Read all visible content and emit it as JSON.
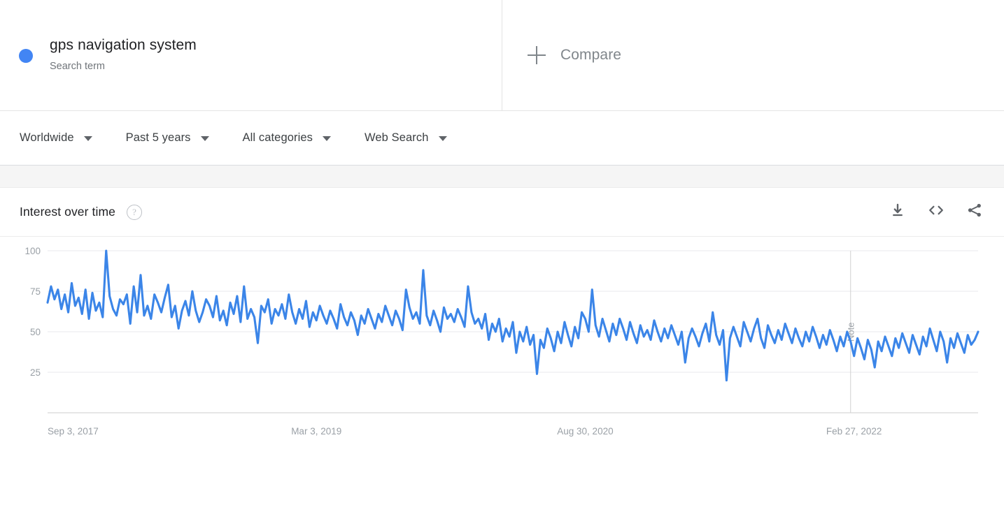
{
  "term": {
    "dot_color": "#4285f4",
    "title": "gps navigation system",
    "subtitle": "Search term"
  },
  "compare": {
    "label": "Compare",
    "plus_icon": "plus-icon"
  },
  "filters": [
    {
      "label": "Worldwide",
      "icon": "chevron-down-icon"
    },
    {
      "label": "Past 5 years",
      "icon": "chevron-down-icon"
    },
    {
      "label": "All categories",
      "icon": "chevron-down-icon"
    },
    {
      "label": "Web Search",
      "icon": "chevron-down-icon"
    }
  ],
  "card": {
    "title": "Interest over time",
    "help_icon": "help-circle-icon",
    "help_glyph": "?",
    "actions": [
      {
        "name": "download-icon",
        "tooltip": "Download"
      },
      {
        "name": "embed-code-icon",
        "tooltip": "Embed"
      },
      {
        "name": "share-icon",
        "tooltip": "Share"
      }
    ]
  },
  "chart_data": {
    "type": "line",
    "title": "Interest over time",
    "xlabel": "",
    "ylabel": "",
    "line_color": "#3b85e8",
    "ylim": [
      0,
      100
    ],
    "y_ticks": [
      100,
      75,
      50,
      25
    ],
    "grid": true,
    "legend_position": "top-left",
    "x_tick_labels": [
      "Sep 3, 2017",
      "Mar 3, 2019",
      "Aug 30, 2020",
      "Feb 27, 2022"
    ],
    "x_tick_indices": [
      0,
      78,
      156,
      234
    ],
    "annotations": [
      {
        "label": "Note",
        "x_index": 233,
        "orientation": "vertical"
      }
    ],
    "series": [
      {
        "name": "gps navigation system",
        "color": "#3b85e8",
        "values": [
          68,
          78,
          70,
          76,
          64,
          73,
          62,
          80,
          66,
          71,
          61,
          76,
          58,
          74,
          63,
          68,
          59,
          100,
          72,
          64,
          60,
          70,
          67,
          73,
          55,
          78,
          62,
          85,
          60,
          66,
          58,
          73,
          68,
          62,
          71,
          79,
          59,
          66,
          52,
          63,
          69,
          60,
          75,
          63,
          56,
          62,
          70,
          66,
          59,
          72,
          57,
          63,
          54,
          68,
          61,
          72,
          56,
          78,
          58,
          64,
          59,
          43,
          66,
          62,
          70,
          55,
          64,
          60,
          67,
          58,
          73,
          62,
          55,
          64,
          58,
          69,
          53,
          62,
          57,
          66,
          60,
          55,
          63,
          58,
          52,
          67,
          59,
          54,
          62,
          57,
          48,
          60,
          55,
          64,
          58,
          52,
          61,
          56,
          66,
          60,
          54,
          63,
          58,
          51,
          76,
          65,
          58,
          62,
          55,
          88,
          60,
          54,
          63,
          57,
          50,
          65,
          58,
          61,
          56,
          64,
          59,
          53,
          78,
          62,
          55,
          58,
          52,
          61,
          45,
          55,
          50,
          58,
          44,
          52,
          47,
          56,
          37,
          50,
          44,
          53,
          42,
          48,
          24,
          45,
          40,
          52,
          46,
          38,
          50,
          43,
          56,
          48,
          41,
          53,
          46,
          62,
          58,
          50,
          76,
          54,
          47,
          58,
          51,
          44,
          55,
          48,
          58,
          52,
          45,
          56,
          49,
          43,
          54,
          47,
          51,
          45,
          57,
          50,
          44,
          52,
          46,
          54,
          48,
          42,
          50,
          31,
          46,
          52,
          47,
          41,
          49,
          55,
          44,
          62,
          48,
          42,
          51,
          20,
          46,
          53,
          47,
          41,
          56,
          50,
          44,
          52,
          58,
          46,
          40,
          54,
          48,
          43,
          51,
          45,
          55,
          49,
          43,
          52,
          46,
          41,
          50,
          44,
          53,
          47,
          40,
          48,
          42,
          51,
          45,
          38,
          47,
          41,
          50,
          44,
          35,
          46,
          40,
          33,
          45,
          39,
          28,
          44,
          38,
          47,
          41,
          35,
          46,
          40,
          49,
          43,
          37,
          48,
          42,
          36,
          47,
          41,
          52,
          45,
          38,
          50,
          44,
          31,
          46,
          40,
          49,
          43,
          37,
          48,
          42,
          45,
          50
        ]
      }
    ]
  }
}
